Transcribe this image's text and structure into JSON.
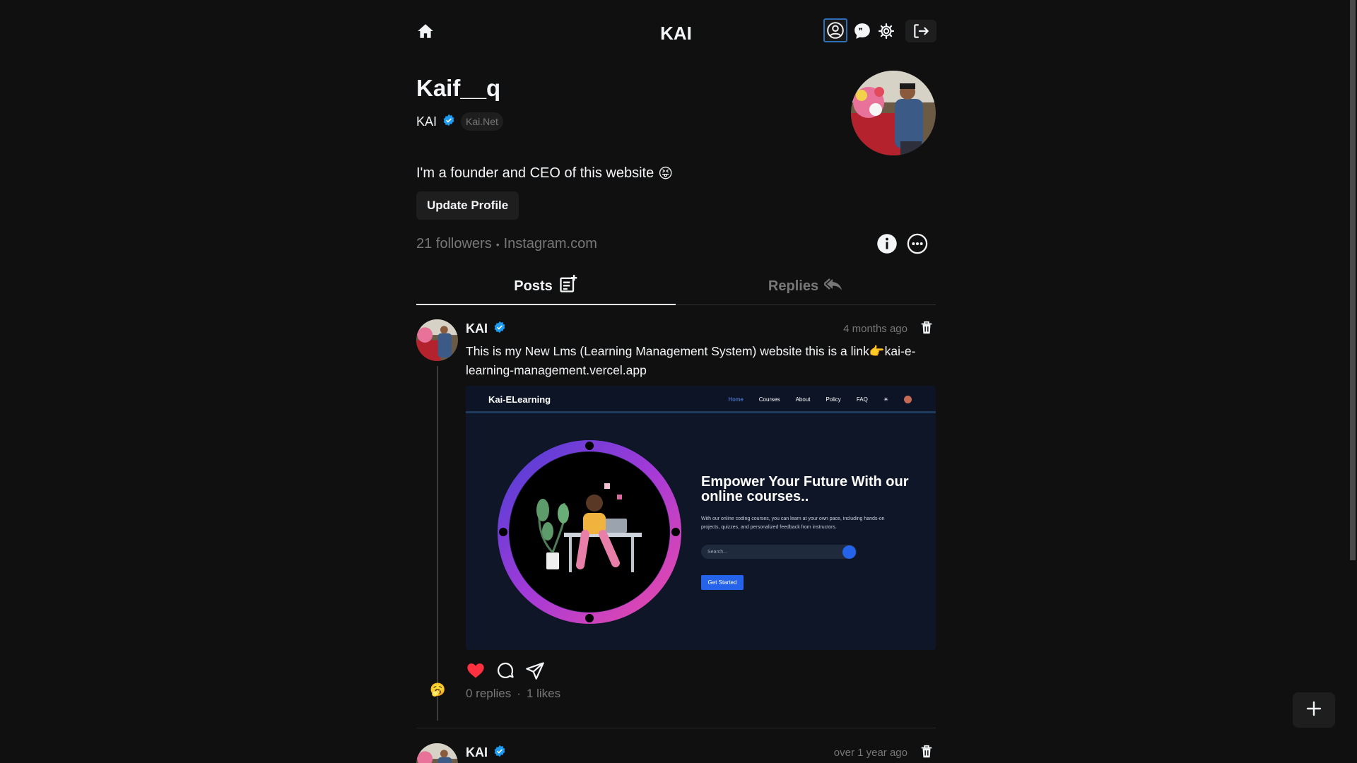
{
  "header": {
    "title": "KAI",
    "icons": [
      "home-icon",
      "user-profile-icon",
      "chat-quote-icon",
      "gear-icon",
      "logout-icon"
    ]
  },
  "profile": {
    "username": "Kaif__q",
    "name": "KAI",
    "domain_badge": "Kai.Net",
    "bio": "I'm a founder and CEO of this website",
    "bio_emoji": "😝",
    "update_button": "Update Profile",
    "followers": "21 followers",
    "separator": "•",
    "link": "Instagram.com"
  },
  "tabs": [
    {
      "label": "Posts",
      "active": true
    },
    {
      "label": "Replies",
      "active": false
    }
  ],
  "posts": [
    {
      "author": "KAI",
      "time": "4 months ago",
      "text": "This is my New Lms (Learning Management System) website this is a link👉kai-e-learning-management.vercel.app",
      "replies": "0 replies",
      "dot": "·",
      "likes": "1 likes",
      "liked": true,
      "reply_avatar_emoji": "🥱",
      "image": {
        "brand": "Kai-ELearning",
        "nav": [
          "Home",
          "Courses",
          "About",
          "Policy",
          "FAQ"
        ],
        "headline": "Empower Your Future With our online courses..",
        "description": "With our online coding courses, you can learn at your own pace, including hands-on projects, quizzes, and personalized feedback from instructors.",
        "search_placeholder": "Search...",
        "cta": "Get Started"
      }
    },
    {
      "author": "KAI",
      "time": "over 1 year ago"
    }
  ],
  "fab_icon": "plus-icon",
  "colors": {
    "background": "#101010",
    "text": "#f3f5f7",
    "muted": "#777777",
    "verified": "#1d9bf0",
    "like": "#ff3040",
    "accent": "#2563eb"
  }
}
